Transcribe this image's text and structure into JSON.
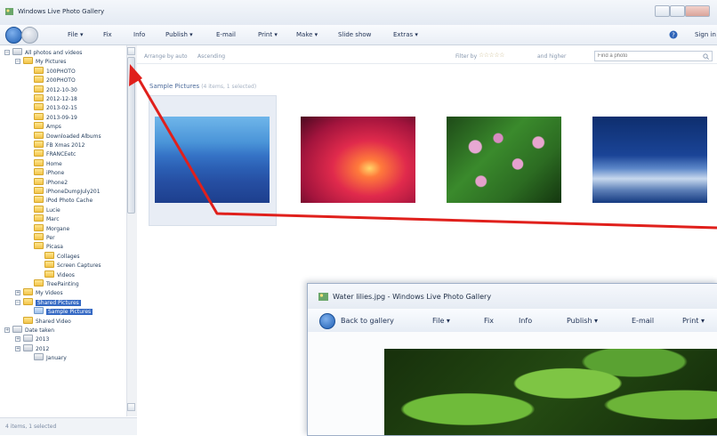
{
  "window": {
    "title": "Windows Live Photo Gallery"
  },
  "toolbar": {
    "items": [
      "File",
      "Fix",
      "Info",
      "Publish",
      "E-mail",
      "Print",
      "Make",
      "Slide show",
      "Extras"
    ],
    "help": "",
    "sign_in": "Sign in"
  },
  "tree": {
    "items": [
      {
        "label": "All photos and videos",
        "indent": 0,
        "icon": "doc"
      },
      {
        "label": "My Pictures",
        "indent": 1,
        "icon": "folder"
      },
      {
        "label": "100PHOTO",
        "indent": 2,
        "icon": "folder"
      },
      {
        "label": "200PHOTO",
        "indent": 2,
        "icon": "folder"
      },
      {
        "label": "2012-10-30",
        "indent": 2,
        "icon": "folder"
      },
      {
        "label": "2012-12-18",
        "indent": 2,
        "icon": "folder"
      },
      {
        "label": "2013-02-15",
        "indent": 2,
        "icon": "folder"
      },
      {
        "label": "2013-09-19",
        "indent": 2,
        "icon": "folder"
      },
      {
        "label": "Amps",
        "indent": 2,
        "icon": "folder"
      },
      {
        "label": "Downloaded Albums",
        "indent": 2,
        "icon": "folder"
      },
      {
        "label": "FB Xmas 2012",
        "indent": 2,
        "icon": "folder"
      },
      {
        "label": "FRANCEetc",
        "indent": 2,
        "icon": "folder"
      },
      {
        "label": "Home",
        "indent": 2,
        "icon": "folder"
      },
      {
        "label": "iPhone",
        "indent": 2,
        "icon": "folder"
      },
      {
        "label": "iPhone2",
        "indent": 2,
        "icon": "folder"
      },
      {
        "label": "iPhoneDumpJuly201",
        "indent": 2,
        "icon": "folder"
      },
      {
        "label": "iPod Photo Cache",
        "indent": 2,
        "icon": "folder"
      },
      {
        "label": "Lucie",
        "indent": 2,
        "icon": "folder"
      },
      {
        "label": "Marc",
        "indent": 2,
        "icon": "folder"
      },
      {
        "label": "Morgane",
        "indent": 2,
        "icon": "folder"
      },
      {
        "label": "Per",
        "indent": 2,
        "icon": "folder"
      },
      {
        "label": "Picasa",
        "indent": 2,
        "icon": "folder"
      },
      {
        "label": "Collages",
        "indent": 3,
        "icon": "folder"
      },
      {
        "label": "Screen Captures",
        "indent": 3,
        "icon": "folder"
      },
      {
        "label": "Videos",
        "indent": 3,
        "icon": "folder"
      },
      {
        "label": "TreePainting",
        "indent": 2,
        "icon": "folder"
      },
      {
        "label": "My Videos",
        "indent": 1,
        "icon": "folder"
      },
      {
        "label": "Shared Pictures",
        "indent": 1,
        "icon": "folder",
        "selected": true
      },
      {
        "label": "Sample Pictures",
        "indent": 2,
        "icon": "blue",
        "selected": true
      },
      {
        "label": "Shared Video",
        "indent": 1,
        "icon": "folder"
      },
      {
        "label": "Date taken",
        "indent": 0,
        "icon": "doc"
      },
      {
        "label": "2013",
        "indent": 1,
        "icon": "doc"
      },
      {
        "label": "2012",
        "indent": 1,
        "icon": "doc"
      },
      {
        "label": "January",
        "indent": 2,
        "icon": "doc"
      }
    ]
  },
  "arrange": {
    "arrange_by": "Arrange by auto",
    "order": "Ascending",
    "filter_label": "Filter by",
    "filter_suffix": "and higher",
    "search_placeholder": "Find a photo"
  },
  "group": {
    "title": "Sample Pictures",
    "meta": "(4 items, 1 selected)"
  },
  "thumbnails": [
    "Blue hills",
    "Sunset",
    "Water lilies",
    "Winter"
  ],
  "status": {
    "text": "4 items, 1 selected"
  },
  "viewer": {
    "title": "Water lilies.jpg - Windows Live Photo Gallery",
    "back_label": "Back to gallery",
    "items": [
      "File",
      "Fix",
      "Info",
      "Publish",
      "E-mail",
      "Print"
    ]
  },
  "colors": {
    "annotation": "#e0201c",
    "selection": "#3569c4"
  }
}
